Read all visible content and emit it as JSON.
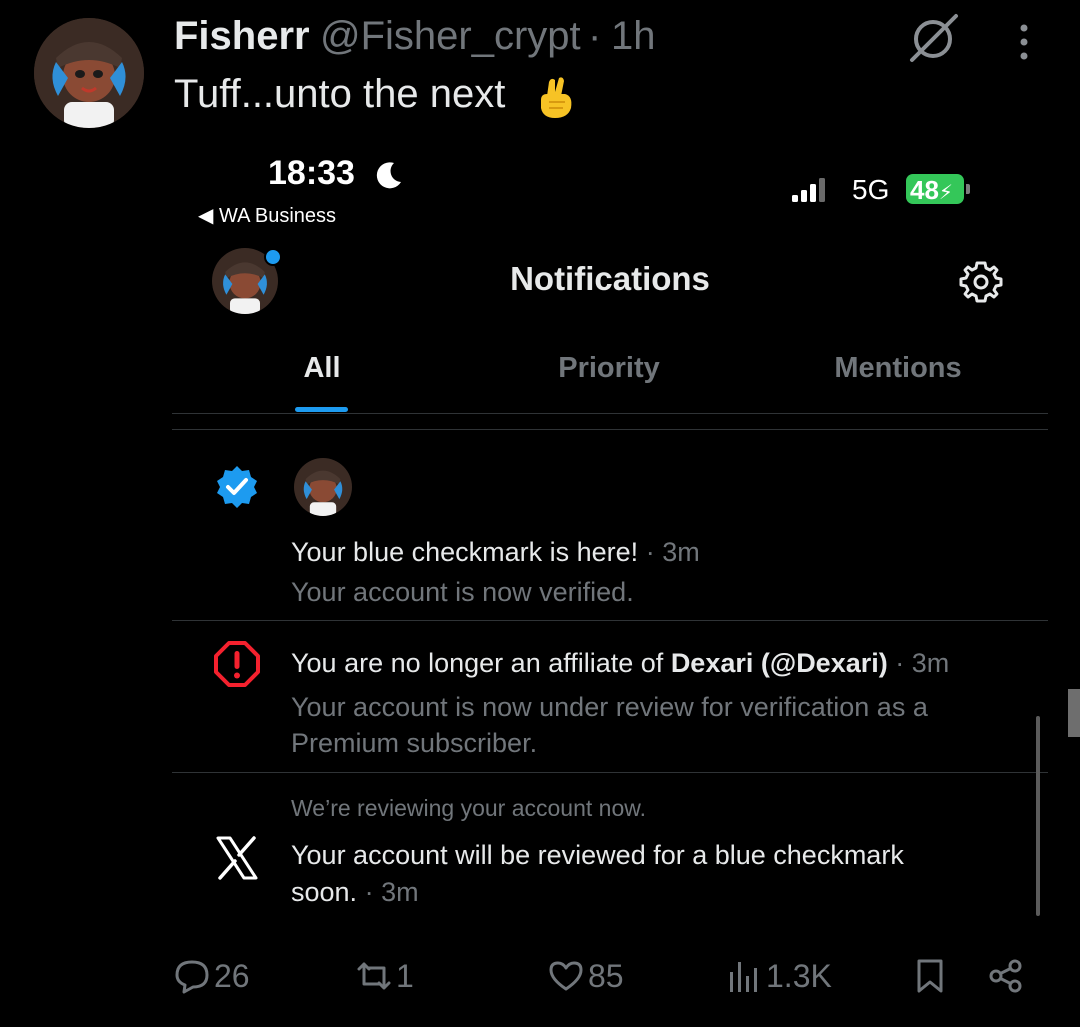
{
  "tweet": {
    "author_name": "Fisherr",
    "handle": "@Fisher_crypt",
    "separator": "·",
    "time": "1h",
    "text": "Tuff...unto the next",
    "emoji_icon": "crossed-fingers-emoji",
    "actions": {
      "replies": "26",
      "reposts": "1",
      "likes": "85",
      "views": "1.3K"
    }
  },
  "phone": {
    "clock": "18:33",
    "back_app": "WA Business",
    "network": "5G",
    "battery": "48",
    "header_title": "Notifications",
    "tabs": [
      {
        "label": "All",
        "active": true
      },
      {
        "label": "Priority",
        "active": false
      },
      {
        "label": "Mentions",
        "active": false
      }
    ],
    "notifications": [
      {
        "icon": "verified-badge-icon",
        "title": "Your blue checkmark is here!",
        "time": "· 3m",
        "subtitle": "Your account is now verified."
      },
      {
        "icon": "alert-icon",
        "title_prefix": "You are no longer an affiliate of",
        "title_bold": "Dexari (@Dexari)",
        "time": "· 3m",
        "subtitle_line1": "Your account is now under review for verification as a",
        "subtitle_line2": "Premium subscriber."
      },
      {
        "icon": "x-logo-icon",
        "pre_title": "We’re reviewing your account now.",
        "title_line1": "Your account will be reviewed for a blue checkmark",
        "title_line2": "soon.",
        "time": "· 3m"
      }
    ]
  },
  "colors": {
    "background": "#000000",
    "text_primary": "#e7e9ea",
    "text_secondary": "#71767b",
    "accent": "#1d9bf0",
    "alert": "#f4212e",
    "battery": "#34c759"
  }
}
